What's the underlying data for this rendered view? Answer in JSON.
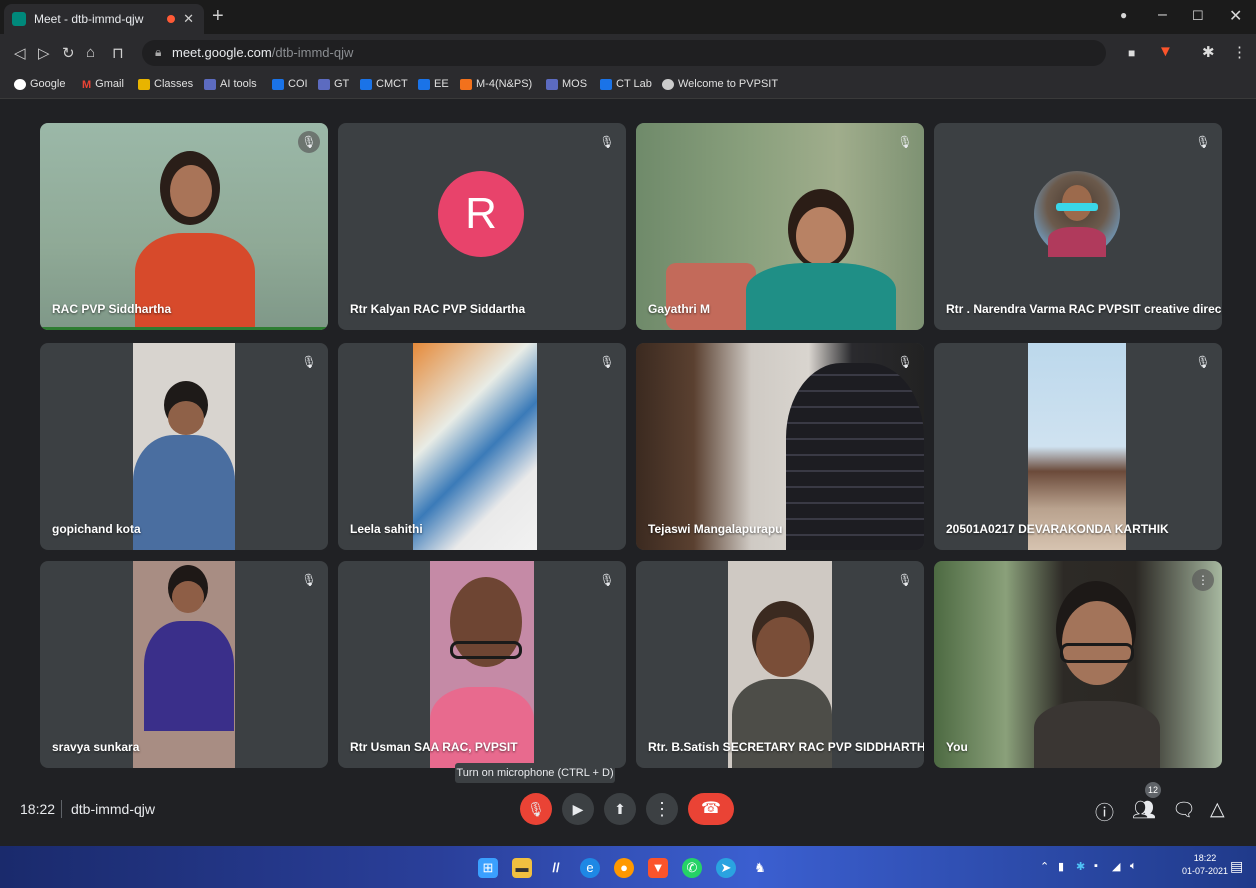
{
  "browser": {
    "tab_title": "Meet - dtb-immd-qjw",
    "url_host": "meet.google.com",
    "url_path": "/dtb-immd-qjw",
    "bookmarks": [
      "Google",
      "Gmail",
      "Classes",
      "AI tools",
      "COI",
      "GT",
      "CMCT",
      "EE",
      "M-4(N&PS)",
      "MOS",
      "CT Lab",
      "Welcome to PVPSIT"
    ]
  },
  "tiles": [
    {
      "name": "RAC PVP Siddhartha"
    },
    {
      "name": "Rtr Kalyan RAC PVP Siddartha",
      "initial": "R"
    },
    {
      "name": "Gayathri M"
    },
    {
      "name": "Rtr . Narendra Varma RAC PVPSIT creative direc..."
    },
    {
      "name": "gopichand kota"
    },
    {
      "name": "Leela sahithi"
    },
    {
      "name": "Tejaswi Mangalapurapu"
    },
    {
      "name": "20501A0217 DEVARAKONDA KARTHIK"
    },
    {
      "name": "sravya sunkara"
    },
    {
      "name": "Rtr Usman SAA RAC, PVPSIT"
    },
    {
      "name": "Rtr. B.Satish SECRETARY RAC PVP SIDDHARTHA"
    },
    {
      "name": "You"
    }
  ],
  "bottom": {
    "time": "18:22",
    "meeting_code": "dtb-immd-qjw",
    "tooltip": "Turn on microphone (CTRL + D)",
    "participant_count": "12"
  },
  "taskbar": {
    "time": "18:22",
    "date": "01-07-2021"
  }
}
